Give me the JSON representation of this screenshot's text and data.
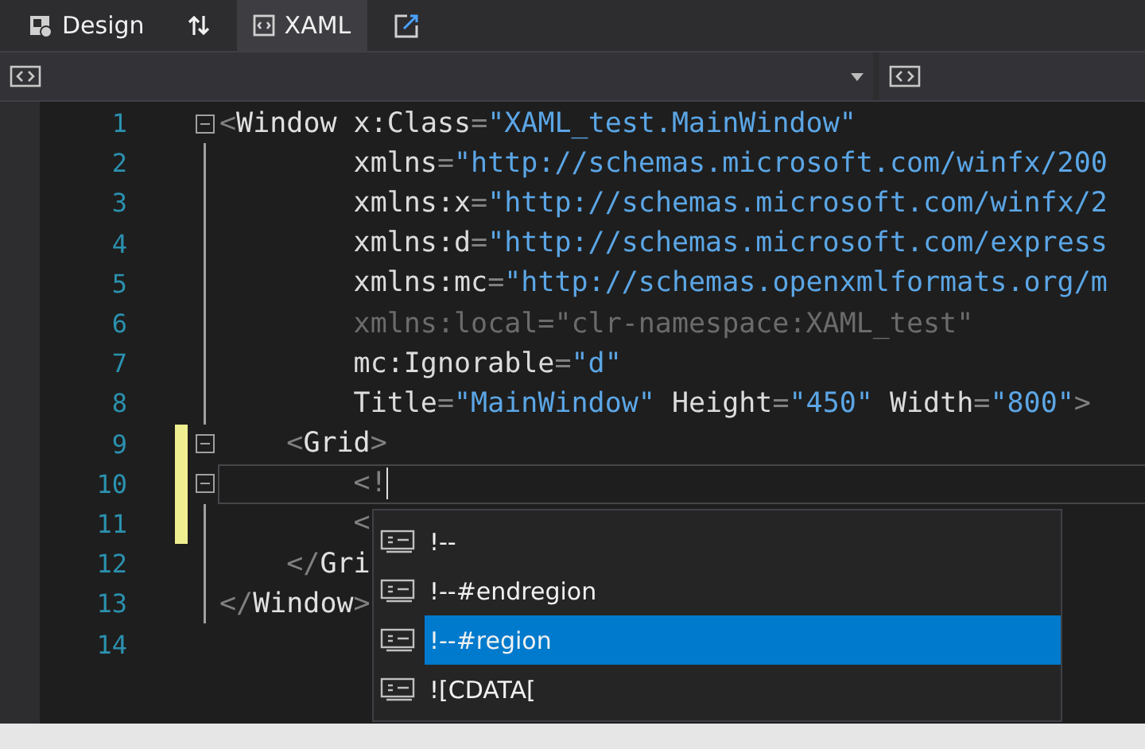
{
  "tabs": [
    {
      "label": "Design",
      "kind": "design",
      "selected": false
    },
    {
      "label": "XAML",
      "kind": "xaml",
      "selected": true
    }
  ],
  "editor": {
    "lines": [
      {
        "number": "1",
        "collapsible": true,
        "in_fold": false,
        "changed": false,
        "current": false,
        "tokens": [
          {
            "text": "<",
            "kind": "punct"
          },
          {
            "text": "Window",
            "kind": "name"
          },
          {
            "text": " x:Class",
            "kind": "attr"
          },
          {
            "text": "=",
            "kind": "punct"
          },
          {
            "text": "\"XAML_test.MainWindow\"",
            "kind": "value"
          }
        ]
      },
      {
        "number": "2",
        "collapsible": false,
        "in_fold": true,
        "changed": false,
        "current": false,
        "tokens": [
          {
            "text": "        xmlns",
            "kind": "attr"
          },
          {
            "text": "=",
            "kind": "punct"
          },
          {
            "text": "\"http://schemas.microsoft.com/winfx/200",
            "kind": "value"
          }
        ]
      },
      {
        "number": "3",
        "collapsible": false,
        "in_fold": true,
        "changed": false,
        "current": false,
        "tokens": [
          {
            "text": "        xmlns:x",
            "kind": "attr"
          },
          {
            "text": "=",
            "kind": "punct"
          },
          {
            "text": "\"http://schemas.microsoft.com/winfx/2",
            "kind": "value"
          }
        ]
      },
      {
        "number": "4",
        "collapsible": false,
        "in_fold": true,
        "changed": false,
        "current": false,
        "tokens": [
          {
            "text": "        xmlns:d",
            "kind": "attr"
          },
          {
            "text": "=",
            "kind": "punct"
          },
          {
            "text": "\"http://schemas.microsoft.com/express",
            "kind": "value"
          }
        ]
      },
      {
        "number": "5",
        "collapsible": false,
        "in_fold": true,
        "changed": false,
        "current": false,
        "tokens": [
          {
            "text": "        xmlns:mc",
            "kind": "attr"
          },
          {
            "text": "=",
            "kind": "punct"
          },
          {
            "text": "\"http://schemas.openxmlformats.org/m",
            "kind": "value"
          }
        ]
      },
      {
        "number": "6",
        "collapsible": false,
        "in_fold": true,
        "changed": false,
        "current": false,
        "tokens": [
          {
            "text": "        xmlns:local=\"clr-namespace:XAML_test\"",
            "kind": "faded"
          }
        ]
      },
      {
        "number": "7",
        "collapsible": false,
        "in_fold": true,
        "changed": false,
        "current": false,
        "tokens": [
          {
            "text": "        mc:Ignorable",
            "kind": "attr"
          },
          {
            "text": "=",
            "kind": "punct"
          },
          {
            "text": "\"d\"",
            "kind": "value"
          }
        ]
      },
      {
        "number": "8",
        "collapsible": false,
        "in_fold": true,
        "changed": false,
        "current": false,
        "tokens": [
          {
            "text": "        Title",
            "kind": "attr"
          },
          {
            "text": "=",
            "kind": "punct"
          },
          {
            "text": "\"MainWindow\"",
            "kind": "value"
          },
          {
            "text": " Height",
            "kind": "attr"
          },
          {
            "text": "=",
            "kind": "punct"
          },
          {
            "text": "\"450\"",
            "kind": "value"
          },
          {
            "text": " Width",
            "kind": "attr"
          },
          {
            "text": "=",
            "kind": "punct"
          },
          {
            "text": "\"800\"",
            "kind": "value"
          },
          {
            "text": ">",
            "kind": "punct"
          }
        ]
      },
      {
        "number": "9",
        "collapsible": true,
        "in_fold": false,
        "changed": true,
        "current": false,
        "tokens": [
          {
            "text": "    <",
            "kind": "punct"
          },
          {
            "text": "Grid",
            "kind": "name"
          },
          {
            "text": ">",
            "kind": "punct"
          }
        ]
      },
      {
        "number": "10",
        "collapsible": true,
        "in_fold": false,
        "changed": true,
        "current": true,
        "tokens": [
          {
            "text": "        <!",
            "kind": "punct"
          }
        ]
      },
      {
        "number": "11",
        "collapsible": false,
        "in_fold": true,
        "changed": true,
        "current": false,
        "tokens": [
          {
            "text": "        <",
            "kind": "punct"
          }
        ]
      },
      {
        "number": "12",
        "collapsible": false,
        "in_fold": true,
        "changed": false,
        "current": false,
        "tokens": [
          {
            "text": "    </",
            "kind": "punct"
          },
          {
            "text": "Gri",
            "kind": "name"
          }
        ]
      },
      {
        "number": "13",
        "collapsible": false,
        "in_fold": true,
        "changed": false,
        "current": false,
        "tokens": [
          {
            "text": "</",
            "kind": "punct"
          },
          {
            "text": "Window",
            "kind": "name"
          },
          {
            "text": ">",
            "kind": "punct"
          }
        ]
      },
      {
        "number": "14",
        "collapsible": false,
        "in_fold": false,
        "changed": false,
        "current": false
      }
    ]
  },
  "completion": {
    "items": [
      {
        "label": "!--",
        "selected": false
      },
      {
        "label": "!--#endregion",
        "selected": false
      },
      {
        "label": "!--#region",
        "selected": true
      },
      {
        "label": "![CDATA[",
        "selected": false
      }
    ]
  }
}
